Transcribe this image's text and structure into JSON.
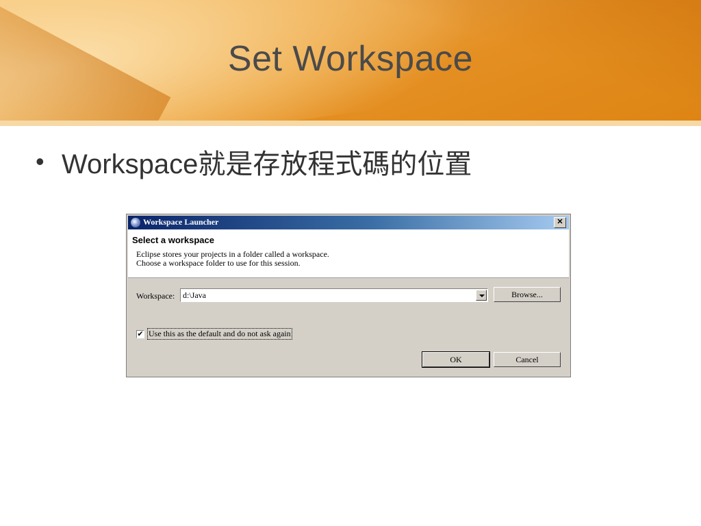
{
  "slide": {
    "title": "Set Workspace",
    "bullet_symbol": "•",
    "bullet_text": "Workspace就是存放程式碼的位置"
  },
  "dialog": {
    "title": "Workspace Launcher",
    "close_symbol": "✕",
    "header_title": "Select a workspace",
    "header_line1": "Eclipse stores your projects in a folder called a workspace.",
    "header_line2": "Choose a workspace folder to use for this session.",
    "workspace_label": "Workspace:",
    "workspace_value": "d:\\Java",
    "browse_label": "Browse...",
    "checkbox_checked": true,
    "checkbox_mark": "✔",
    "checkbox_label": "Use this as the default and do not ask again",
    "ok_label": "OK",
    "cancel_label": "Cancel"
  },
  "colors": {
    "header_orange": "#e48f22",
    "titlebar_blue": "#0a246a"
  }
}
